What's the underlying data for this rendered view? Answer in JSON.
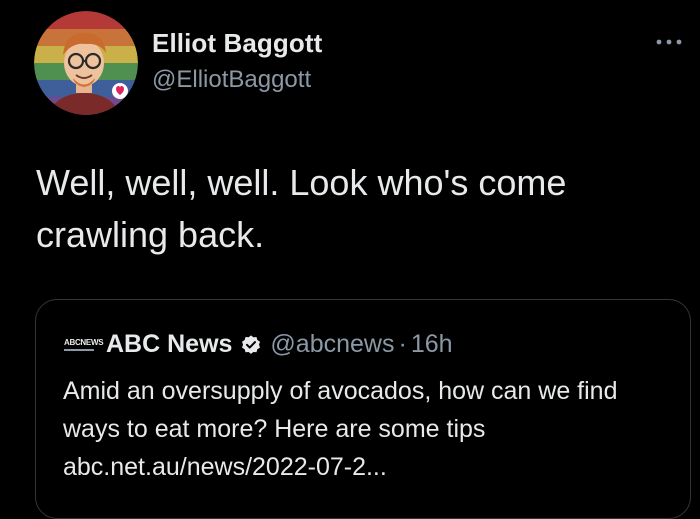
{
  "author": {
    "name": "Elliot Baggott",
    "handle": "@ElliotBaggott",
    "avatar_icon": "cartoon-avatar-rainbow"
  },
  "tweet": {
    "text": "Well, well, well. Look who's come\ncrawling back."
  },
  "more_icon": "more-dots-icon",
  "quote": {
    "logo_text": "ABCNEWS",
    "name": "ABC News",
    "verified_icon": "verified-badge-icon",
    "handle": "@abcnews",
    "separator": "·",
    "time": "16h",
    "text": "Amid an oversupply of avocados, how can we find ways to eat more? Here are some tips abc.net.au/news/2022-07-2..."
  },
  "colors": {
    "background": "#000000",
    "text": "#e7e9ea",
    "muted": "#8b98a5",
    "border": "#333639"
  }
}
